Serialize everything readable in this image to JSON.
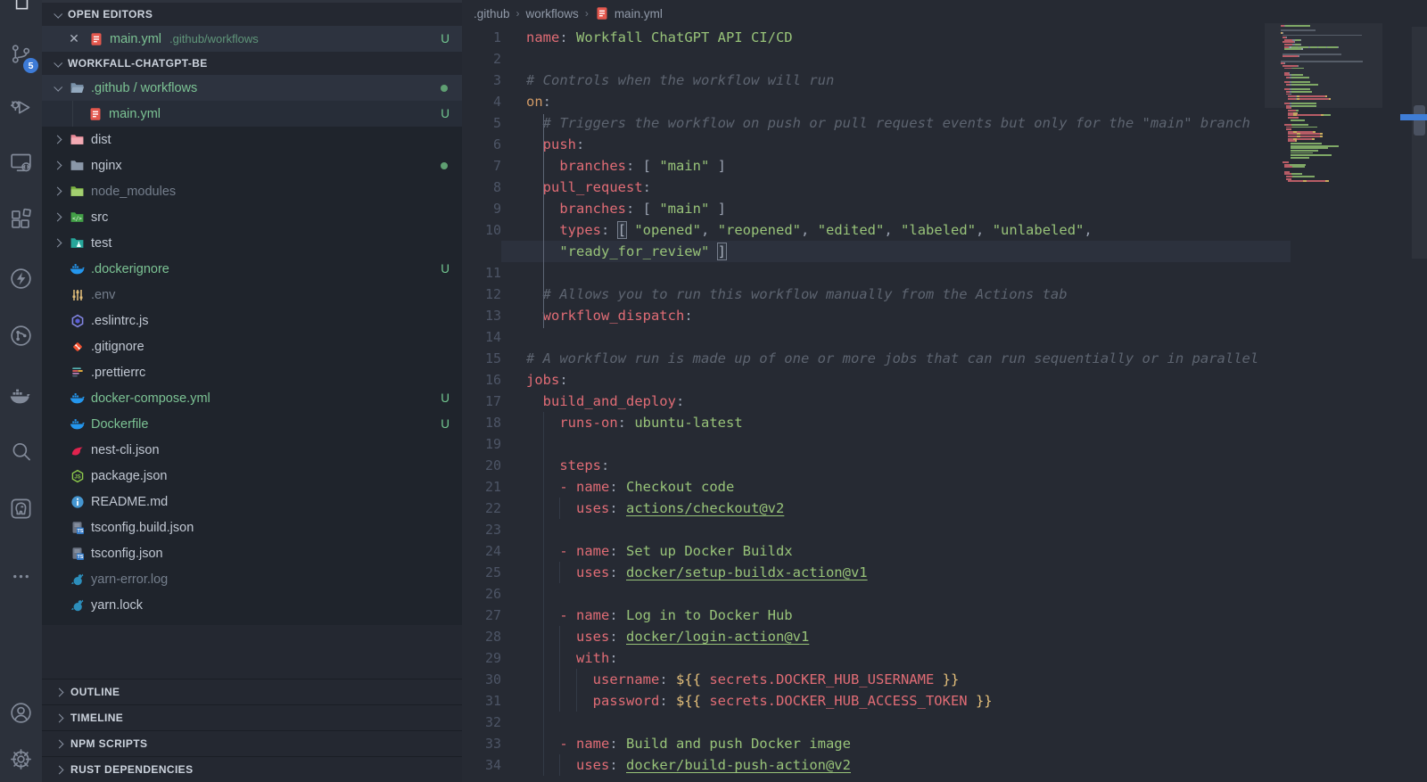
{
  "activity_bar": {
    "items": [
      {
        "icon": "scm",
        "name": "source-control",
        "badge": "5"
      },
      {
        "icon": "debug",
        "name": "run-and-debug"
      },
      {
        "icon": "remote",
        "name": "remote-explorer"
      },
      {
        "icon": "extensions",
        "name": "extensions"
      },
      {
        "icon": "thunder",
        "name": "thunder-client"
      },
      {
        "icon": "gitgraph",
        "name": "git-graph"
      },
      {
        "icon": "docker",
        "name": "docker"
      },
      {
        "icon": "search",
        "name": "search"
      },
      {
        "icon": "postgres",
        "name": "postgres-explorer"
      },
      {
        "icon": "more",
        "name": "more-views"
      }
    ],
    "bottom_items": [
      {
        "icon": "account",
        "name": "accounts"
      },
      {
        "icon": "settings",
        "name": "manage-settings"
      }
    ]
  },
  "sidebar": {
    "open_editors": {
      "header": "OPEN EDITORS",
      "files": [
        {
          "icon": "yaml",
          "label": "main.yml",
          "desc": ".github/workflows",
          "badge": "U",
          "color": "green",
          "close": "✕"
        }
      ]
    },
    "explorer_header": "WORKFALL-CHATGPT-BE",
    "tree": [
      {
        "icon": "folder-github",
        "label": ".github / workflows",
        "indent": 1,
        "chevron": "down",
        "color": "green",
        "dot": true,
        "sel": "sel"
      },
      {
        "icon": "yaml",
        "label": "main.yml",
        "indent": 2,
        "badge": "U",
        "color": "green",
        "sel": "sel2",
        "guide": true
      },
      {
        "icon": "folder-dist",
        "label": "dist",
        "indent": 1,
        "chevron": "right"
      },
      {
        "icon": "folder-nginx",
        "label": "nginx",
        "indent": 1,
        "chevron": "right",
        "dot": true
      },
      {
        "icon": "folder-node",
        "label": "node_modules",
        "indent": 1,
        "chevron": "right",
        "color": "gray"
      },
      {
        "icon": "folder-src",
        "label": "src",
        "indent": 1,
        "chevron": "right"
      },
      {
        "icon": "folder-test",
        "label": "test",
        "indent": 1,
        "chevron": "right"
      },
      {
        "icon": "docker-file",
        "label": ".dockerignore",
        "badge": "U",
        "color": "green"
      },
      {
        "icon": "env",
        "label": ".env",
        "color": "gray"
      },
      {
        "icon": "eslint",
        "label": ".eslintrc.js"
      },
      {
        "icon": "git",
        "label": ".gitignore"
      },
      {
        "icon": "prettier",
        "label": ".prettierrc"
      },
      {
        "icon": "docker-file",
        "label": "docker-compose.yml",
        "badge": "U",
        "color": "green"
      },
      {
        "icon": "docker-file",
        "label": "Dockerfile",
        "badge": "U",
        "color": "green"
      },
      {
        "icon": "nest",
        "label": "nest-cli.json"
      },
      {
        "icon": "node",
        "label": "package.json"
      },
      {
        "icon": "readme",
        "label": "README.md"
      },
      {
        "icon": "ts",
        "label": "tsconfig.build.json"
      },
      {
        "icon": "ts",
        "label": "tsconfig.json"
      },
      {
        "icon": "yarn",
        "label": "yarn-error.log",
        "color": "gray"
      },
      {
        "icon": "yarn",
        "label": "yarn.lock"
      }
    ],
    "panels": [
      "OUTLINE",
      "TIMELINE",
      "NPM SCRIPTS",
      "RUST DEPENDENCIES"
    ]
  },
  "editor": {
    "breadcrumb": {
      "items": [
        ".github",
        "workflows",
        "main.yml"
      ],
      "file_icon": "yaml"
    },
    "code": {
      "lines": [
        {
          "n": "1",
          "t": [
            [
              "key",
              "name"
            ],
            [
              "punc",
              ":"
            ],
            [
              "str",
              " Workfall ChatGPT API CI/CD"
            ]
          ]
        },
        {
          "n": "2",
          "t": []
        },
        {
          "n": "3",
          "t": [
            [
              "com",
              "# Controls when the workflow will run"
            ]
          ]
        },
        {
          "n": "4",
          "t": [
            [
              "orange",
              "on"
            ],
            [
              "punc",
              ":"
            ]
          ]
        },
        {
          "n": "5",
          "t": [
            [
              "com",
              "  # Triggers the workflow on push or pull request events but only for the \"main\" branch"
            ]
          ]
        },
        {
          "n": "6",
          "t": [
            [
              "key",
              "  push"
            ],
            [
              "punc",
              ":"
            ]
          ]
        },
        {
          "n": "7",
          "t": [
            [
              "key",
              "    branches"
            ],
            [
              "punc",
              ": [ "
            ],
            [
              "str",
              "\"main\""
            ],
            [
              "punc",
              " ]"
            ]
          ]
        },
        {
          "n": "8",
          "t": [
            [
              "key",
              "  pull_request"
            ],
            [
              "punc",
              ":"
            ]
          ]
        },
        {
          "n": "9",
          "t": [
            [
              "key",
              "    branches"
            ],
            [
              "punc",
              ": [ "
            ],
            [
              "str",
              "\"main\""
            ],
            [
              "punc",
              " ]"
            ]
          ]
        },
        {
          "n": "10",
          "t": [
            [
              "key",
              "    types"
            ],
            [
              "punc",
              ": "
            ],
            [
              "brk",
              "["
            ],
            [
              "str",
              " \"opened\""
            ],
            [
              "punc",
              ","
            ],
            [
              "str",
              " \"reopened\""
            ],
            [
              "punc",
              ","
            ],
            [
              "str",
              " \"edited\""
            ],
            [
              "punc",
              ","
            ],
            [
              "str",
              " \"labeled\""
            ],
            [
              "punc",
              ","
            ],
            [
              "str",
              " \"unlabeled\""
            ],
            [
              "punc",
              ","
            ]
          ]
        },
        {
          "n": "",
          "hl": true,
          "t": [
            [
              "str",
              "    \"ready_for_review\""
            ],
            [
              "punc",
              " "
            ],
            [
              "brk",
              "]"
            ]
          ]
        },
        {
          "n": "11",
          "t": []
        },
        {
          "n": "12",
          "t": [
            [
              "com",
              "  # Allows you to run this workflow manually from the Actions tab"
            ]
          ]
        },
        {
          "n": "13",
          "t": [
            [
              "key",
              "  workflow_dispatch"
            ],
            [
              "punc",
              ":"
            ]
          ]
        },
        {
          "n": "14",
          "t": []
        },
        {
          "n": "15",
          "t": [
            [
              "com",
              "# A workflow run is made up of one or more jobs that can run sequentially or in parallel"
            ]
          ]
        },
        {
          "n": "16",
          "t": [
            [
              "key",
              "jobs"
            ],
            [
              "punc",
              ":"
            ]
          ]
        },
        {
          "n": "17",
          "t": [
            [
              "key",
              "  build_and_deploy"
            ],
            [
              "punc",
              ":"
            ]
          ]
        },
        {
          "n": "18",
          "t": [
            [
              "key",
              "    runs-on"
            ],
            [
              "punc",
              ":"
            ],
            [
              "str",
              " ubuntu-latest"
            ]
          ]
        },
        {
          "n": "19",
          "t": []
        },
        {
          "n": "20",
          "t": [
            [
              "key",
              "    steps"
            ],
            [
              "punc",
              ":"
            ]
          ]
        },
        {
          "n": "21",
          "t": [
            [
              "key",
              "    - name"
            ],
            [
              "punc",
              ":"
            ],
            [
              "str",
              " Checkout code"
            ]
          ]
        },
        {
          "n": "22",
          "t": [
            [
              "key",
              "      uses"
            ],
            [
              "punc",
              ":"
            ],
            [
              "plain",
              " "
            ],
            [
              "link",
              "actions/checkout@v2"
            ]
          ]
        },
        {
          "n": "23",
          "t": []
        },
        {
          "n": "24",
          "t": [
            [
              "key",
              "    - name"
            ],
            [
              "punc",
              ":"
            ],
            [
              "str",
              " Set up Docker Buildx"
            ]
          ]
        },
        {
          "n": "25",
          "t": [
            [
              "key",
              "      uses"
            ],
            [
              "punc",
              ":"
            ],
            [
              "plain",
              " "
            ],
            [
              "link",
              "docker/setup-buildx-action@v1"
            ]
          ]
        },
        {
          "n": "26",
          "t": []
        },
        {
          "n": "27",
          "t": [
            [
              "key",
              "    - name"
            ],
            [
              "punc",
              ":"
            ],
            [
              "str",
              " Log in to Docker Hub"
            ]
          ]
        },
        {
          "n": "28",
          "t": [
            [
              "key",
              "      uses"
            ],
            [
              "punc",
              ":"
            ],
            [
              "plain",
              " "
            ],
            [
              "link",
              "docker/login-action@v1"
            ]
          ]
        },
        {
          "n": "29",
          "t": [
            [
              "key",
              "      with"
            ],
            [
              "punc",
              ":"
            ]
          ]
        },
        {
          "n": "30",
          "t": [
            [
              "key",
              "        username"
            ],
            [
              "punc",
              ":"
            ],
            [
              "plain",
              " "
            ],
            [
              "yellow",
              "${{"
            ],
            [
              "key",
              " secrets.DOCKER_HUB_USERNAME "
            ],
            [
              "yellow",
              "}}"
            ]
          ]
        },
        {
          "n": "31",
          "t": [
            [
              "key",
              "        password"
            ],
            [
              "punc",
              ":"
            ],
            [
              "plain",
              " "
            ],
            [
              "yellow",
              "${{"
            ],
            [
              "key",
              " secrets.DOCKER_HUB_ACCESS_TOKEN "
            ],
            [
              "yellow",
              "}}"
            ]
          ]
        },
        {
          "n": "32",
          "t": []
        },
        {
          "n": "33",
          "t": [
            [
              "key",
              "    - name"
            ],
            [
              "punc",
              ":"
            ],
            [
              "str",
              " Build and push Docker image"
            ]
          ]
        },
        {
          "n": "34",
          "t": [
            [
              "key",
              "      uses"
            ],
            [
              "punc",
              ":"
            ],
            [
              "plain",
              " "
            ],
            [
              "link",
              "docker/build-push-action@v2"
            ]
          ]
        }
      ]
    },
    "minimap_extra_rows": [
      {
        "i": 6,
        "s": [
          [
            "key",
            5
          ]
        ]
      },
      {
        "i": 8,
        "s": [
          [
            "key",
            8
          ],
          [
            "str",
            3
          ]
        ]
      },
      {
        "i": 8,
        "s": [
          [
            "key",
            5
          ],
          [
            "orange",
            5
          ]
        ]
      },
      {
        "i": 8,
        "s": [
          [
            "key",
            5
          ],
          [
            "yellow",
            4
          ],
          [
            "key",
            26
          ],
          [
            "yellow",
            3
          ],
          [
            "str",
            7
          ]
        ]
      },
      {
        "i": 8,
        "s": [
          [
            "key",
            11
          ]
        ]
      },
      {
        "i": 10,
        "s": [
          [
            "str",
            16
          ]
        ]
      },
      {
        "i": 0,
        "s": []
      },
      {
        "i": 4,
        "s": [
          [
            "key",
            7
          ],
          [
            "str",
            19
          ]
        ]
      },
      {
        "i": 6,
        "s": [
          [
            "key",
            6
          ],
          [
            "link",
            27
          ]
        ]
      },
      {
        "i": 6,
        "s": [
          [
            "key",
            5
          ]
        ]
      },
      {
        "i": 8,
        "s": [
          [
            "key",
            5
          ],
          [
            "yellow",
            4
          ],
          [
            "key",
            17
          ],
          [
            "yellow",
            3
          ]
        ]
      },
      {
        "i": 8,
        "s": [
          [
            "key",
            9
          ],
          [
            "yellow",
            4
          ],
          [
            "key",
            21
          ],
          [
            "yellow",
            3
          ]
        ]
      },
      {
        "i": 8,
        "s": [
          [
            "key",
            9
          ],
          [
            "yellow",
            4
          ],
          [
            "key",
            21
          ],
          [
            "yellow",
            3
          ]
        ]
      },
      {
        "i": 8,
        "s": [
          [
            "key",
            5
          ],
          [
            "yellow",
            4
          ],
          [
            "key",
            16
          ],
          [
            "yellow",
            3
          ]
        ]
      },
      {
        "i": 8,
        "s": [
          [
            "key",
            7
          ],
          [
            "orange",
            2
          ]
        ]
      },
      {
        "i": 10,
        "s": [
          [
            "str",
            34
          ]
        ]
      },
      {
        "i": 10,
        "s": [
          [
            "str",
            52
          ]
        ]
      },
      {
        "i": 10,
        "s": [
          [
            "str",
            40
          ]
        ]
      },
      {
        "i": 10,
        "s": [
          [
            "str",
            30
          ]
        ]
      },
      {
        "i": 10,
        "s": [
          [
            "str",
            24
          ]
        ]
      },
      {
        "i": 10,
        "s": [
          [
            "str",
            44
          ]
        ]
      },
      {
        "i": 10,
        "s": [
          [
            "str",
            20
          ]
        ]
      },
      {
        "i": 0,
        "s": []
      },
      {
        "i": 2,
        "s": [
          [
            "key",
            7
          ]
        ]
      },
      {
        "i": 4,
        "s": [
          [
            "key",
            6
          ],
          [
            "str",
            17
          ]
        ]
      },
      {
        "i": 4,
        "s": [
          [
            "key",
            8
          ],
          [
            "str",
            14
          ]
        ]
      },
      {
        "i": 0,
        "s": []
      },
      {
        "i": 4,
        "s": [
          [
            "key",
            6
          ]
        ]
      },
      {
        "i": 4,
        "s": [
          [
            "key",
            7
          ],
          [
            "str",
            12
          ]
        ]
      },
      {
        "i": 6,
        "s": [
          [
            "key",
            6
          ],
          [
            "link",
            24
          ]
        ]
      },
      {
        "i": 6,
        "s": [
          [
            "key",
            5
          ]
        ]
      },
      {
        "i": 8,
        "s": [
          [
            "key",
            16
          ],
          [
            "yellow",
            4
          ],
          [
            "key",
            20
          ],
          [
            "yellow",
            3
          ]
        ]
      }
    ]
  },
  "colors": {
    "accent_blue": "#3d7bd7",
    "git_untracked_green": "#73c991",
    "key_red": "#e06c75",
    "string_green": "#98c379",
    "yellow": "#e5c07b",
    "orange": "#d19a66",
    "comment_gray": "#5d6470"
  }
}
